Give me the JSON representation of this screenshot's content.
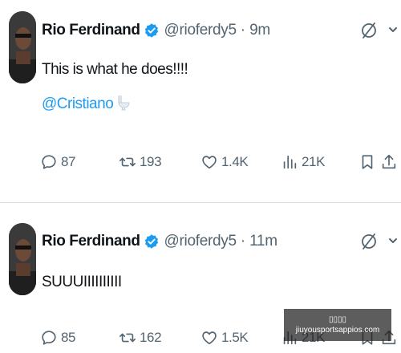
{
  "tweets": [
    {
      "author_name": "Rio Ferdinand",
      "handle": "@rioferdy5",
      "separator": "·",
      "time": "9m",
      "text_line_1": "This is what he does!!!!",
      "mention": "@Cristiano",
      "emoji": "toilet-emoji",
      "replies": "87",
      "retweets": "193",
      "likes": "1.4K",
      "views": "21K"
    },
    {
      "author_name": "Rio Ferdinand",
      "handle": "@rioferdy5",
      "separator": "·",
      "time": "11m",
      "text_line_1": "SUUUIIIIIIIIII",
      "replies": "85",
      "retweets": "162",
      "likes": "1.5K",
      "views": "21K"
    }
  ],
  "watermark": {
    "line1": "▯▯▯▯",
    "line2": "jiuyousportsappios.com"
  },
  "colors": {
    "text": "#0f1419",
    "secondary": "#536471",
    "accent": "#1d9bf0",
    "divider": "#d6dbdf"
  }
}
